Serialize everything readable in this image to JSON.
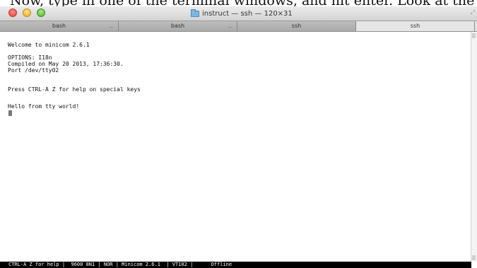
{
  "caption": "Now, type in one of the terminal windows, and hit enter. Look at the other terminal",
  "window": {
    "title": "instruct — ssh — 120×31",
    "title_icon": "folder-icon",
    "fullscreen_icon": "fullscreen-icon",
    "traffic_lights": {
      "close_color": "#e0443a",
      "minimize_color": "#e6a91f",
      "zoom_color": "#4fae2c"
    }
  },
  "tabs": [
    {
      "label": "bash",
      "more": "...",
      "active": false
    },
    {
      "label": "bash",
      "more": "...",
      "active": false
    },
    {
      "label": "ssh",
      "more": "",
      "active": false
    },
    {
      "label": "ssh",
      "more": "",
      "active": true
    }
  ],
  "terminal": {
    "lines": [
      "Welcome to minicom 2.6.1",
      "",
      "OPTIONS: I18n",
      "Compiled on May 20 2013, 17:36:30.",
      "Port /dev/tty02",
      "",
      "Press CTRL-A Z for help on special keys",
      "",
      "Hello from tty world!"
    ],
    "background": "#ffffff",
    "text_color": "#111111"
  },
  "status_bar": {
    "text": "CTRL-A Z for help |  9600 8N1 | NOR | Minicom 2.6.1  | VT102 |      Offline"
  }
}
